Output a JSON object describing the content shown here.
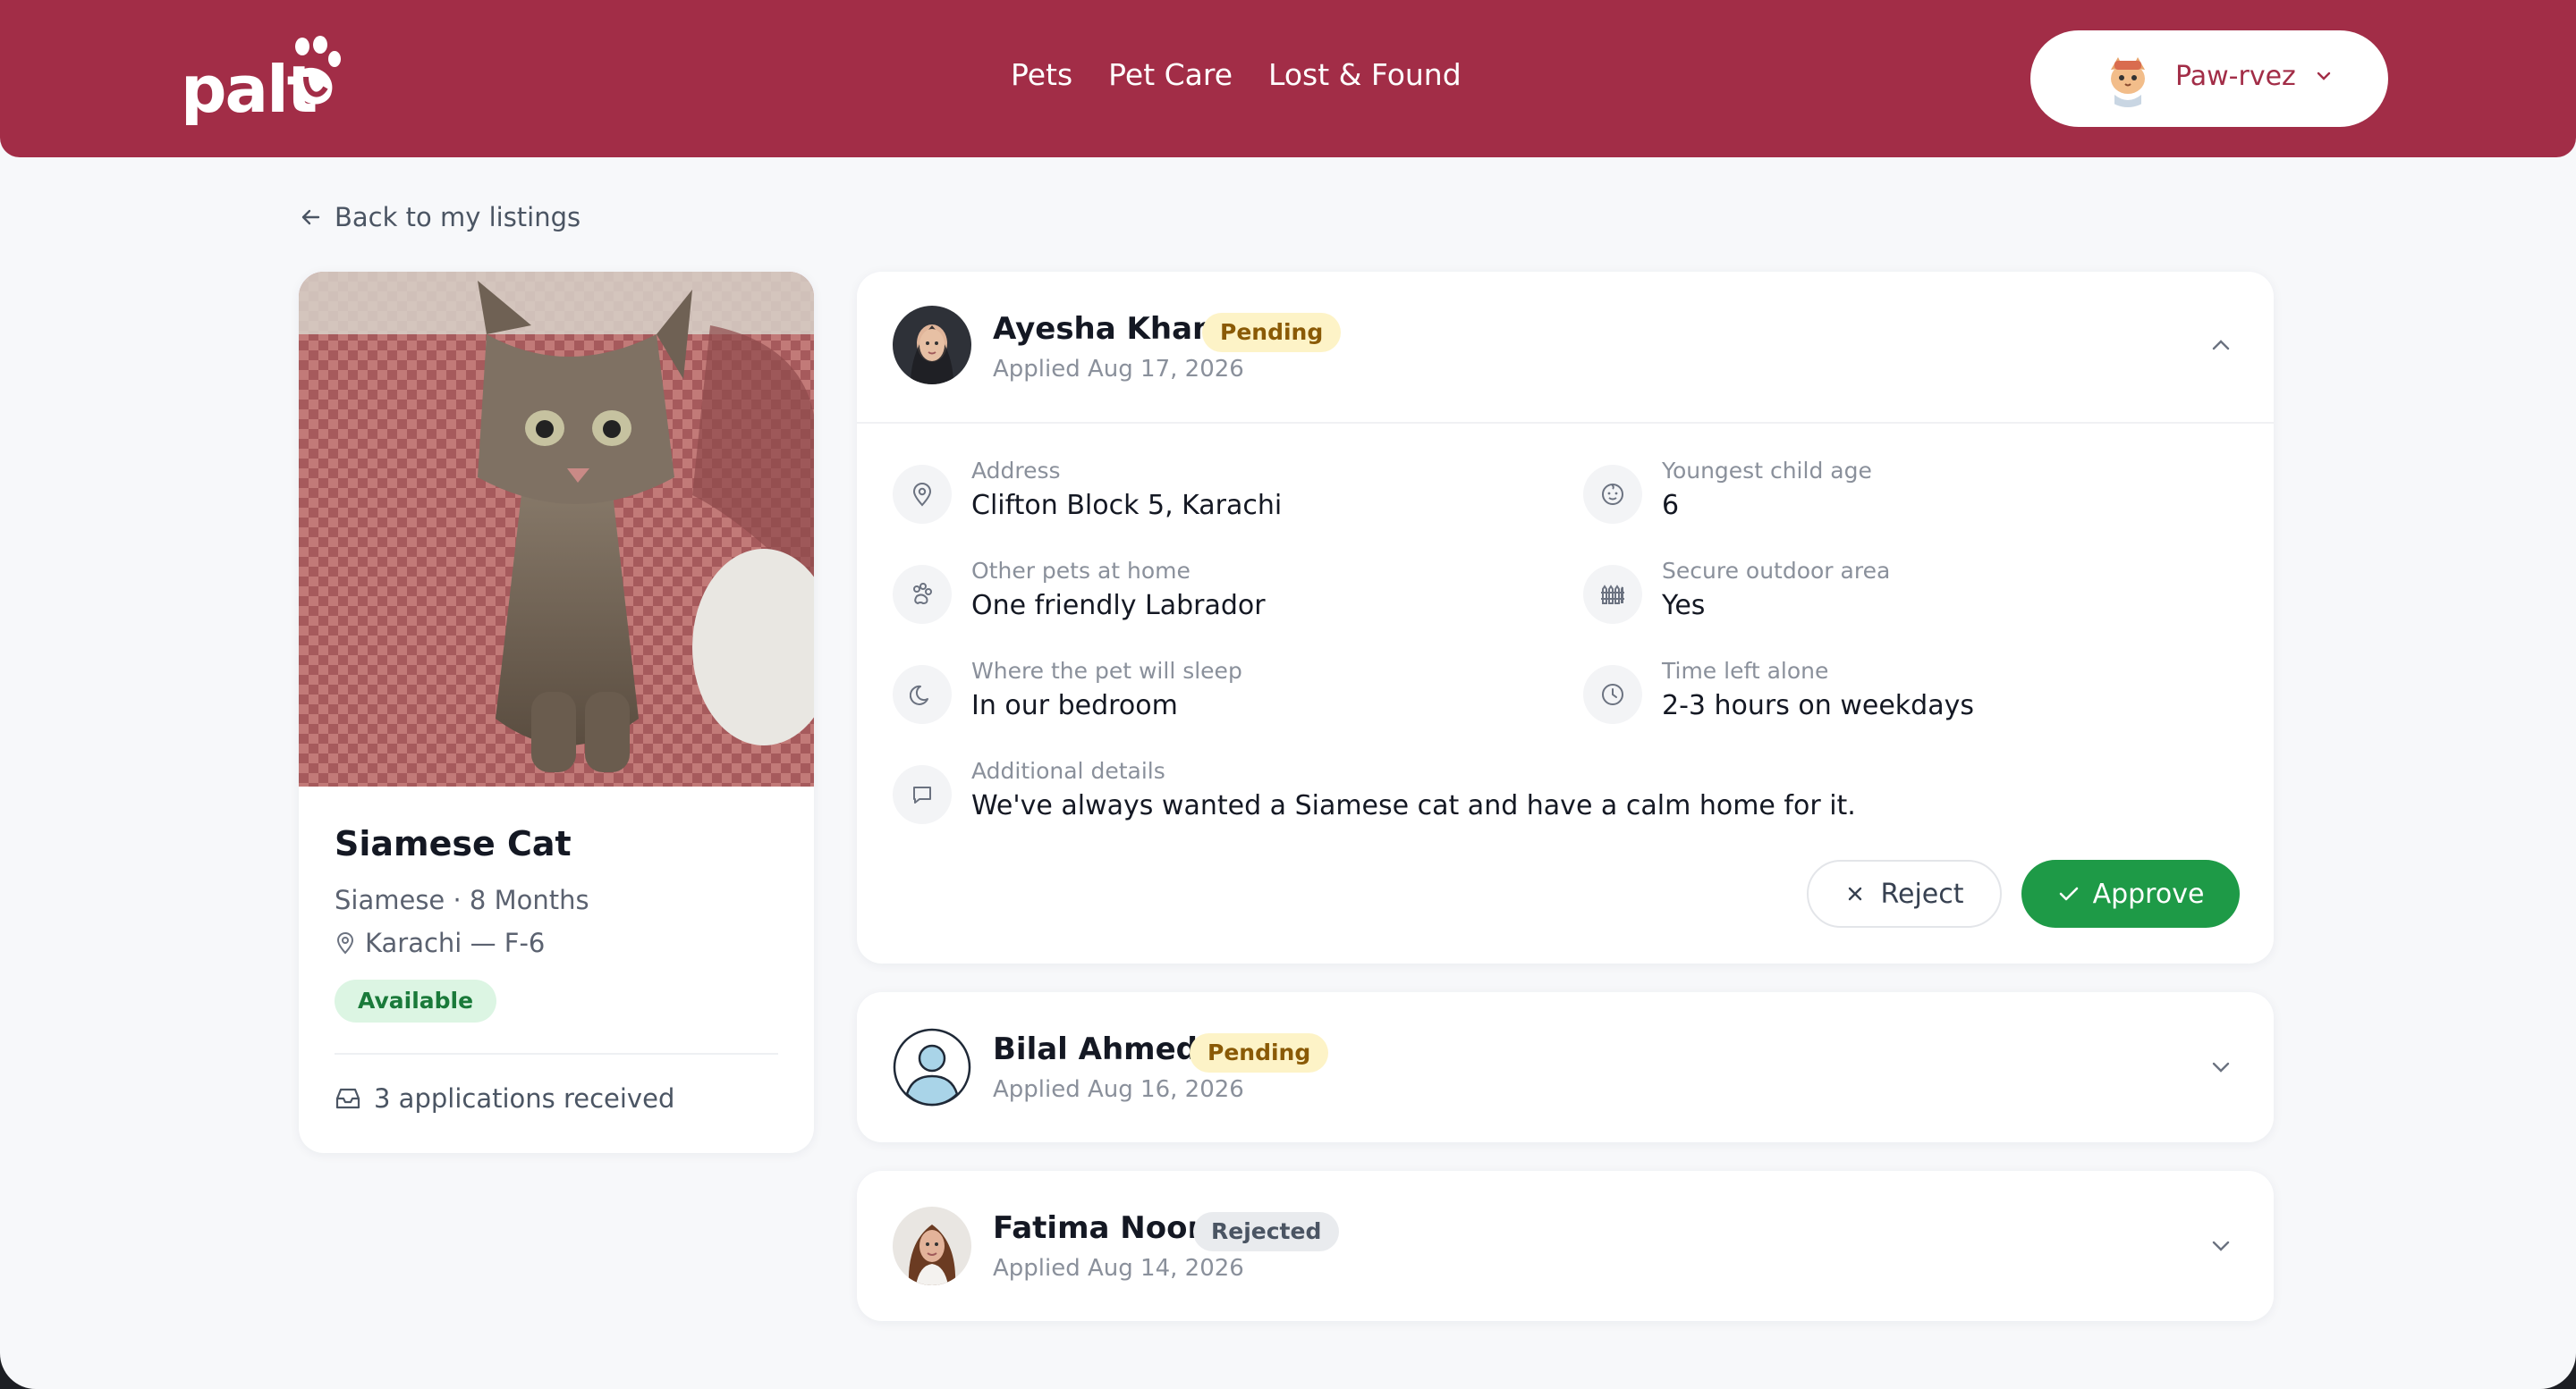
{
  "header": {
    "logo_text": "palt",
    "nav": [
      "Pets",
      "Pet Care",
      "Lost & Found"
    ],
    "user": {
      "name": "Paw-rvez",
      "avatar_icon": "cat-avatar-icon",
      "menu_icon": "chevron-down-icon"
    },
    "bg_color": "#a22d47"
  },
  "back_link": {
    "label": "Back to my listings",
    "icon": "arrow-left-icon"
  },
  "pet": {
    "name": "Siamese Cat",
    "subtitle": "Siamese · 8 Months",
    "location": "Karachi — F-6",
    "status": "Available",
    "applications_text": "3 applications received"
  },
  "applications": [
    {
      "name": "Ayesha Khan",
      "status": "Pending",
      "applied": "Applied Aug 17, 2026",
      "expanded": true,
      "fields": {
        "address": {
          "label": "Address",
          "value": "Clifton Block 5, Karachi",
          "icon": "map-pin-icon"
        },
        "youngest_child": {
          "label": "Youngest child age",
          "value": "6",
          "icon": "baby-face-icon"
        },
        "other_pets": {
          "label": "Other pets at home",
          "value": "One friendly Labrador",
          "icon": "paw-icon"
        },
        "outdoor": {
          "label": "Secure outdoor area",
          "value": "Yes",
          "icon": "fence-icon"
        },
        "sleep": {
          "label": "Where the pet will sleep",
          "value": "In our bedroom",
          "icon": "moon-icon"
        },
        "alone": {
          "label": "Time left alone",
          "value": "2-3 hours on weekdays",
          "icon": "clock-icon"
        },
        "details": {
          "label": "Additional details",
          "value": "We've always wanted a Siamese cat and have a calm home for it.",
          "icon": "message-icon"
        }
      },
      "actions": {
        "reject": "Reject",
        "approve": "Approve"
      }
    },
    {
      "name": "Bilal Ahmed",
      "status": "Pending",
      "applied": "Applied Aug 16, 2026",
      "expanded": false
    },
    {
      "name": "Fatima Noor",
      "status": "Rejected",
      "applied": "Applied Aug 14, 2026",
      "expanded": false
    }
  ],
  "colors": {
    "accent": "#a22d47",
    "approve": "#1e9a47",
    "pending_bg": "#fdf3c7",
    "available_bg": "#dcf5e3"
  }
}
